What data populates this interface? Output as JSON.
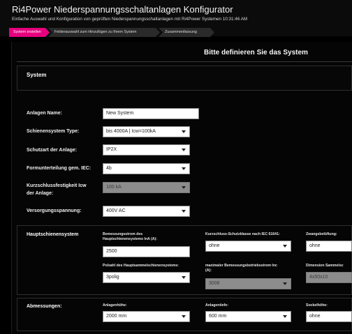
{
  "header": {
    "title": "Ri4Power Niederspannungsschaltanlagen Konfigurator",
    "subtitle": "Einfache Auswahl und Konfiguration von geprüften Niederspannungsschaltanlagen mit Ri4Power Systemen 10:31:46 AM"
  },
  "steps": [
    "System erstellen",
    "Felderauswahl zum Hinzufügen zu Ihrem System",
    "Zusammenfassung"
  ],
  "main": {
    "title": "Bitte definieren Sie das System",
    "section_system": "System"
  },
  "system_form": {
    "anlagen_name": {
      "label": "Anlagen Name:",
      "value": "New System"
    },
    "schienensystem": {
      "label": "Schienensystem Type:",
      "value": "bis 4000A | Icw=100kA"
    },
    "schutzart": {
      "label": "Schutzart der Anlage:",
      "value": "IP2X"
    },
    "formunterteilung": {
      "label": "Formunterteilung gem. IEC:",
      "value": "4b"
    },
    "kurzschluss": {
      "label_line1": "Kurzschlussfestigkeit Icw",
      "label_line2": "der Anlage:",
      "value": "100 kA"
    },
    "versorgung": {
      "label": "Versorgungsspannung:",
      "value": "400V AC"
    }
  },
  "hauptschienen": {
    "title": "Hauptschienensystem",
    "bemessungsstrom": {
      "label_line1": "Bemessungsstrom des",
      "label_line2": "Hauptschienensystems InA (A):",
      "value": "2500"
    },
    "kurzschlussklasse": {
      "label": "Kurzschluss-Schutzklasse nach IEC 61641:",
      "value": "ohne"
    },
    "zwangsbeluftung": {
      "label": "Zwangsbelüftung:",
      "value": "ohne"
    },
    "polzahl": {
      "label": "Polzahl des Hauptsammelschienensystems:",
      "value": "3polig"
    },
    "max_betriebsstrom": {
      "label_line1": "maximaler Bemessungsbetriebsstrom Inc",
      "label_line2": "(A):",
      "value": "3008"
    },
    "dimension": {
      "label": "Dimension Sammelsc",
      "value": "4x50x10"
    }
  },
  "abmessungen": {
    "title": "Abmessungen:",
    "hoehe": {
      "label": "Anlagenhöhe:",
      "value": "2000 mm"
    },
    "tiefe": {
      "label": "Anlagentiefe:",
      "value": "600 mm"
    },
    "sockel": {
      "label": "Sockelhöhe:",
      "value": "ohne"
    }
  },
  "colors": {
    "accent": "#e6007e",
    "background": "#000000"
  }
}
